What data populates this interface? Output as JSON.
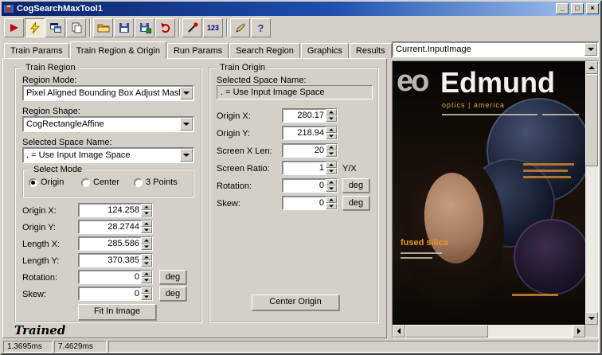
{
  "titlebar": {
    "title": "CogSearchMaxTool1",
    "minimize": "_",
    "maximize": "□",
    "close": "×"
  },
  "toolbar": {
    "numbers_label": "123",
    "help_label": "?"
  },
  "tabs": {
    "items": [
      "Train Params",
      "Train Region & Origin",
      "Run Params",
      "Search Region",
      "Graphics",
      "Results"
    ],
    "active": "Train Region & Origin"
  },
  "image_panel": {
    "selector_value": "Current.InputImage",
    "cover": {
      "logo": "eo",
      "brand": "Edmund",
      "tagline": "optics | america",
      "feature": "fused silica"
    }
  },
  "train_region": {
    "title": "Train Region",
    "region_mode_label": "Region Mode:",
    "region_mode": "Pixel Aligned Bounding Box Adjust Mask",
    "region_shape_label": "Region Shape:",
    "region_shape": "CogRectangleAffine",
    "space_label": "Selected Space Name:",
    "space": ". = Use Input Image Space",
    "select_mode": {
      "title": "Select Mode",
      "options": [
        "Origin",
        "Center",
        "3 Points"
      ],
      "selected": "Origin"
    },
    "fields": [
      {
        "label": "Origin X:",
        "value": "124.258",
        "unit": ""
      },
      {
        "label": "Origin Y:",
        "value": "28.2744",
        "unit": ""
      },
      {
        "label": "Length X:",
        "value": "285.586",
        "unit": ""
      },
      {
        "label": "Length Y:",
        "value": "370.385",
        "unit": ""
      },
      {
        "label": "Rotation:",
        "value": "0",
        "unit": "deg"
      },
      {
        "label": "Skew:",
        "value": "0",
        "unit": "deg"
      }
    ],
    "fit_button": "Fit In Image"
  },
  "train_origin": {
    "title": "Train Origin",
    "space_label": "Selected Space Name:",
    "space": ". = Use Input Image Space",
    "fields": [
      {
        "label": "Origin X:",
        "value": "280.17",
        "unit": ""
      },
      {
        "label": "Origin Y:",
        "value": "218.94",
        "unit": ""
      },
      {
        "label": "Screen X Len:",
        "value": "20",
        "unit": ""
      },
      {
        "label": "Screen Ratio:",
        "value": "1",
        "unit": "Y/X"
      },
      {
        "label": "Rotation:",
        "value": "0",
        "unit": "deg"
      },
      {
        "label": "Skew:",
        "value": "0",
        "unit": "deg"
      }
    ],
    "center_button": "Center Origin"
  },
  "footer": {
    "trained": "Trained"
  },
  "statusbar": {
    "time1": "1.3695ms",
    "time2": "7.4629ms"
  }
}
